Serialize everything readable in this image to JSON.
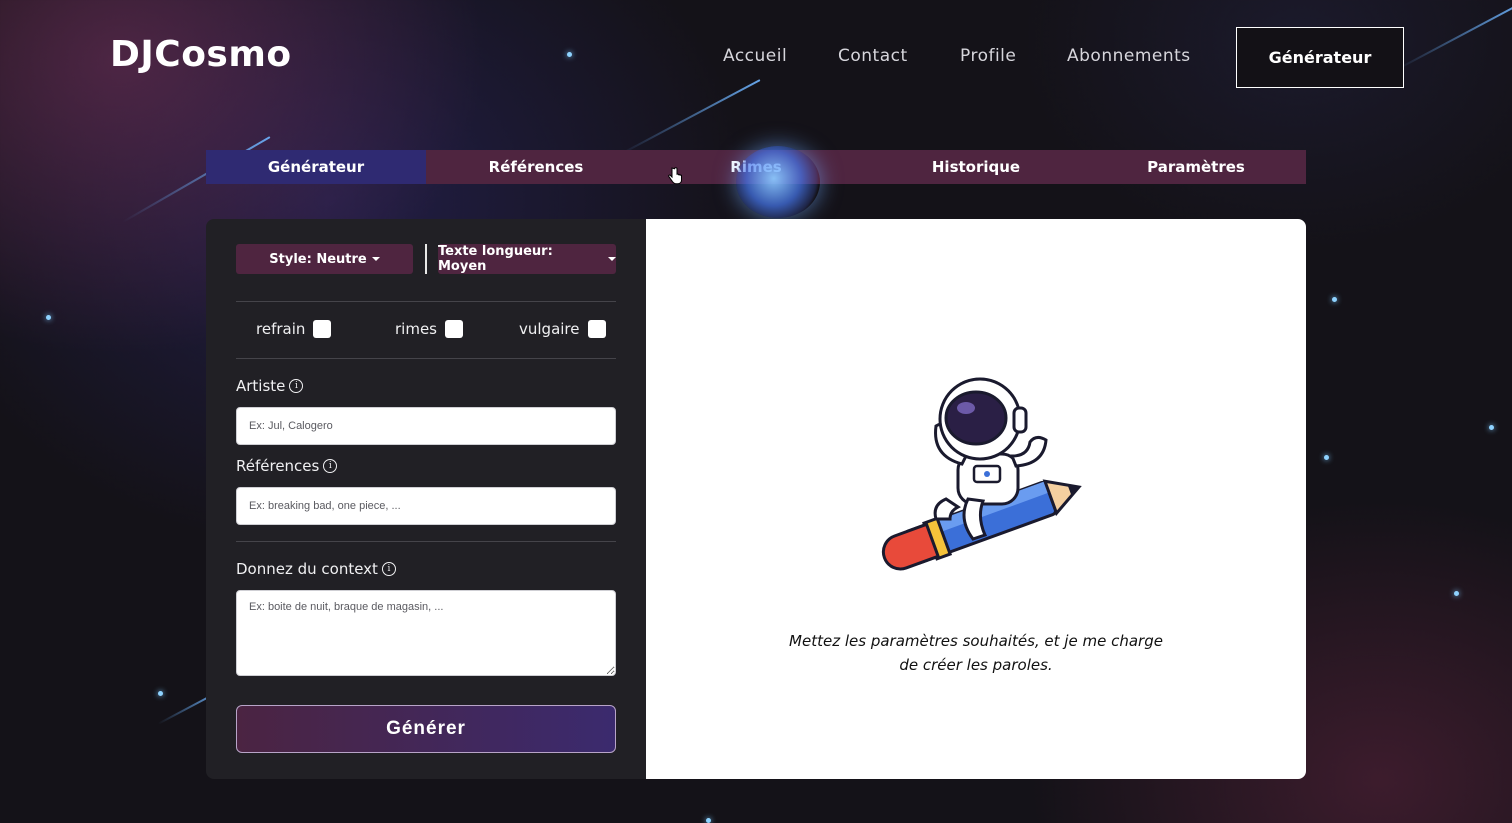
{
  "header": {
    "logo": "DJCosmo",
    "nav": [
      "Accueil",
      "Contact",
      "Profile",
      "Abonnements"
    ],
    "cta": "Générateur"
  },
  "tabs": [
    "Générateur",
    "Références",
    "Rimes",
    "Historique",
    "Paramètres"
  ],
  "active_tab": "Générateur",
  "form": {
    "style_dropdown": "Style: Neutre",
    "length_dropdown": "Texte longueur: Moyen",
    "checkboxes": [
      {
        "label": "refrain",
        "checked": false
      },
      {
        "label": "rimes",
        "checked": false
      },
      {
        "label": "vulgaire",
        "checked": false
      }
    ],
    "artist_label": "Artiste",
    "artist_placeholder": "Ex: Jul, Calogero",
    "references_label": "Références",
    "references_placeholder": "Ex: breaking bad, one piece, ...",
    "context_label": "Donnez du context",
    "context_placeholder": "Ex: boite de nuit, braque de magasin, ...",
    "submit": "Générer"
  },
  "output": {
    "caption_line1": "Mettez les paramètres souhaités, et je me charge",
    "caption_line2": "de créer les paroles."
  },
  "colors": {
    "tab_bg": "#4f2540",
    "tab_active": "#2f2a72",
    "panel_dark": "#212025",
    "page_bg": "#141218"
  }
}
